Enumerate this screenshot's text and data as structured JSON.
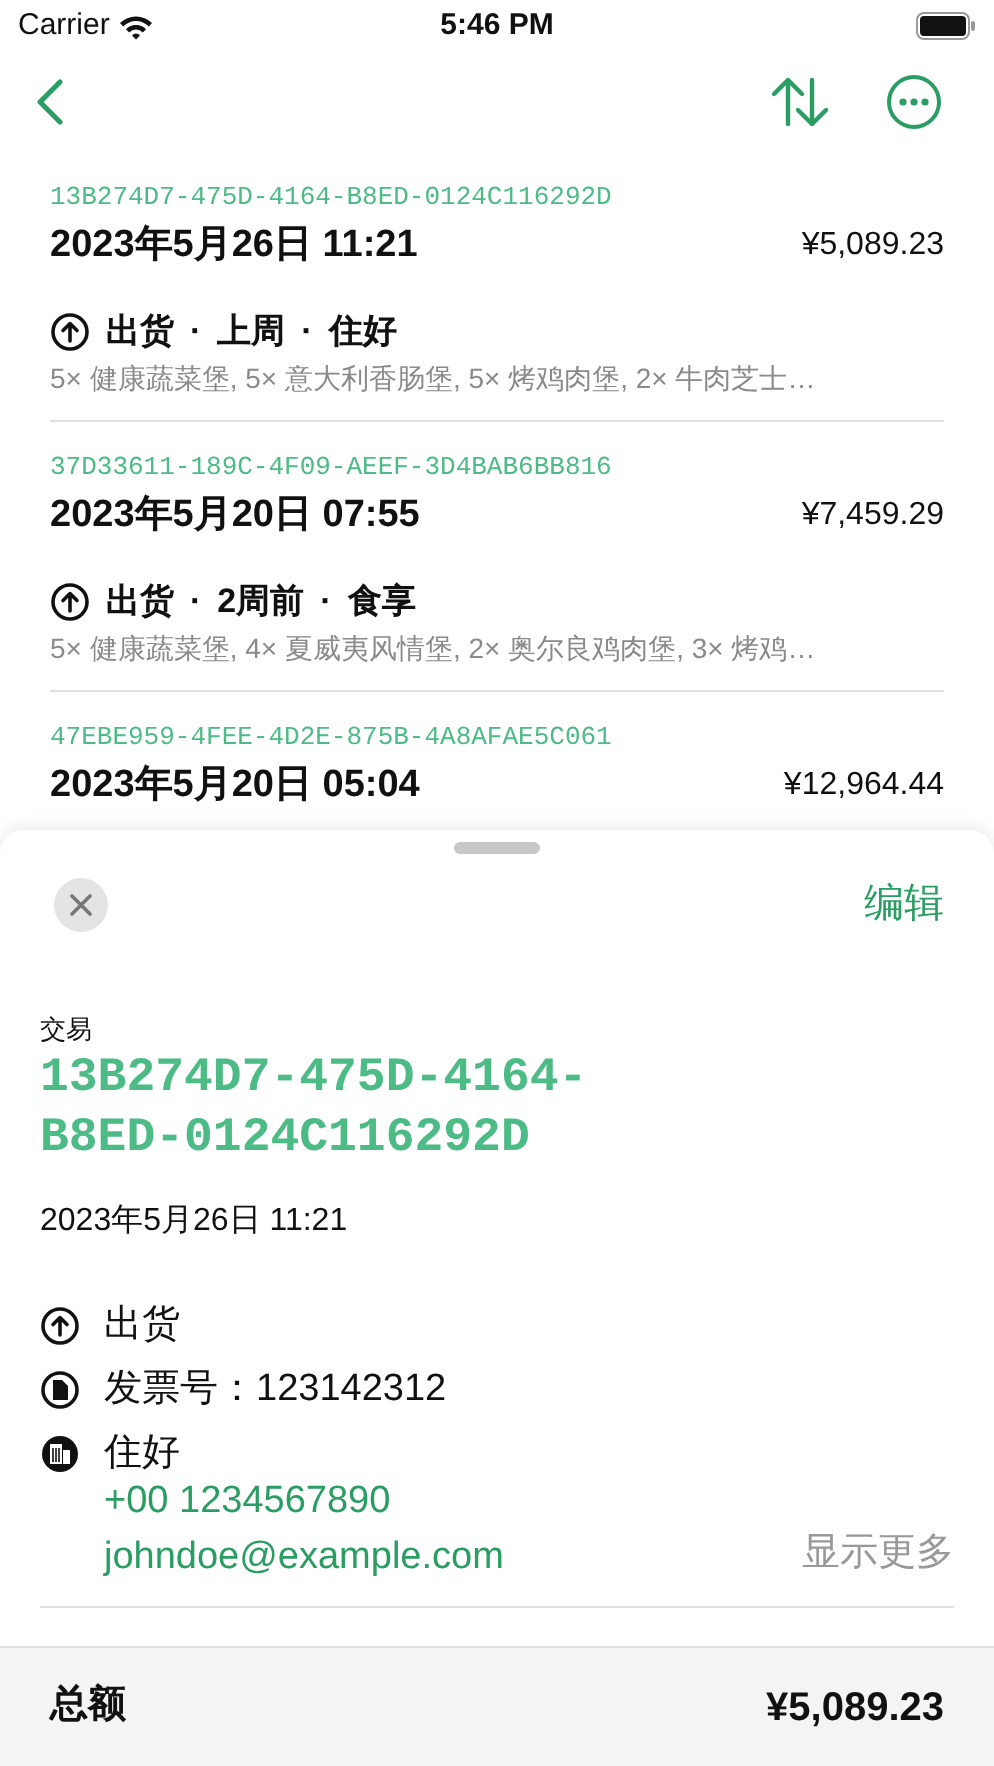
{
  "status_bar": {
    "carrier": "Carrier",
    "time": "5:46 PM"
  },
  "transactions": [
    {
      "id": "13B274D7-475D-4164-B8ED-0124C116292D",
      "date": "2023年5月26日 11:21",
      "amount": "¥5,089.23",
      "meta": [
        {
          "text": "出货"
        },
        {
          "separator": "·",
          "text": "上周"
        },
        {
          "separator": "·",
          "text": "住好"
        }
      ],
      "items": "5× 健康蔬菜堡, 5× 意大利香肠堡, 5× 烤鸡肉堡, 2× 牛肉芝士…"
    },
    {
      "id": "37D33611-189C-4F09-AEEF-3D4BAB6BB816",
      "date": "2023年5月20日 07:55",
      "amount": "¥7,459.29",
      "meta": [
        {
          "text": "出货"
        },
        {
          "separator": "·",
          "text": "2周前"
        },
        {
          "separator": "·",
          "text": "食享"
        }
      ],
      "items": "5× 健康蔬菜堡, 4× 夏威夷风情堡, 2× 奥尔良鸡肉堡, 3× 烤鸡…"
    },
    {
      "id": "47EBE959-4FEE-4D2E-875B-4A8AFAE5C061",
      "date": "2023年5月20日 05:04",
      "amount": "¥12,964.44"
    }
  ],
  "sheet": {
    "edit": "编辑",
    "label": "交易",
    "id": "13B274D7-475D-4164-B8ED-0124C116292D",
    "date": "2023年5月26日 11:21",
    "details": [
      {
        "kind": "direction",
        "text": "出货"
      },
      {
        "kind": "invoice",
        "text": "发票号：123142312"
      },
      {
        "kind": "company",
        "text": "住好",
        "phone": "+00 1234567890",
        "email": "johndoe@example.com"
      }
    ],
    "show_more": "显示更多",
    "total": {
      "label": "总额",
      "value": "¥5,089.23"
    }
  }
}
